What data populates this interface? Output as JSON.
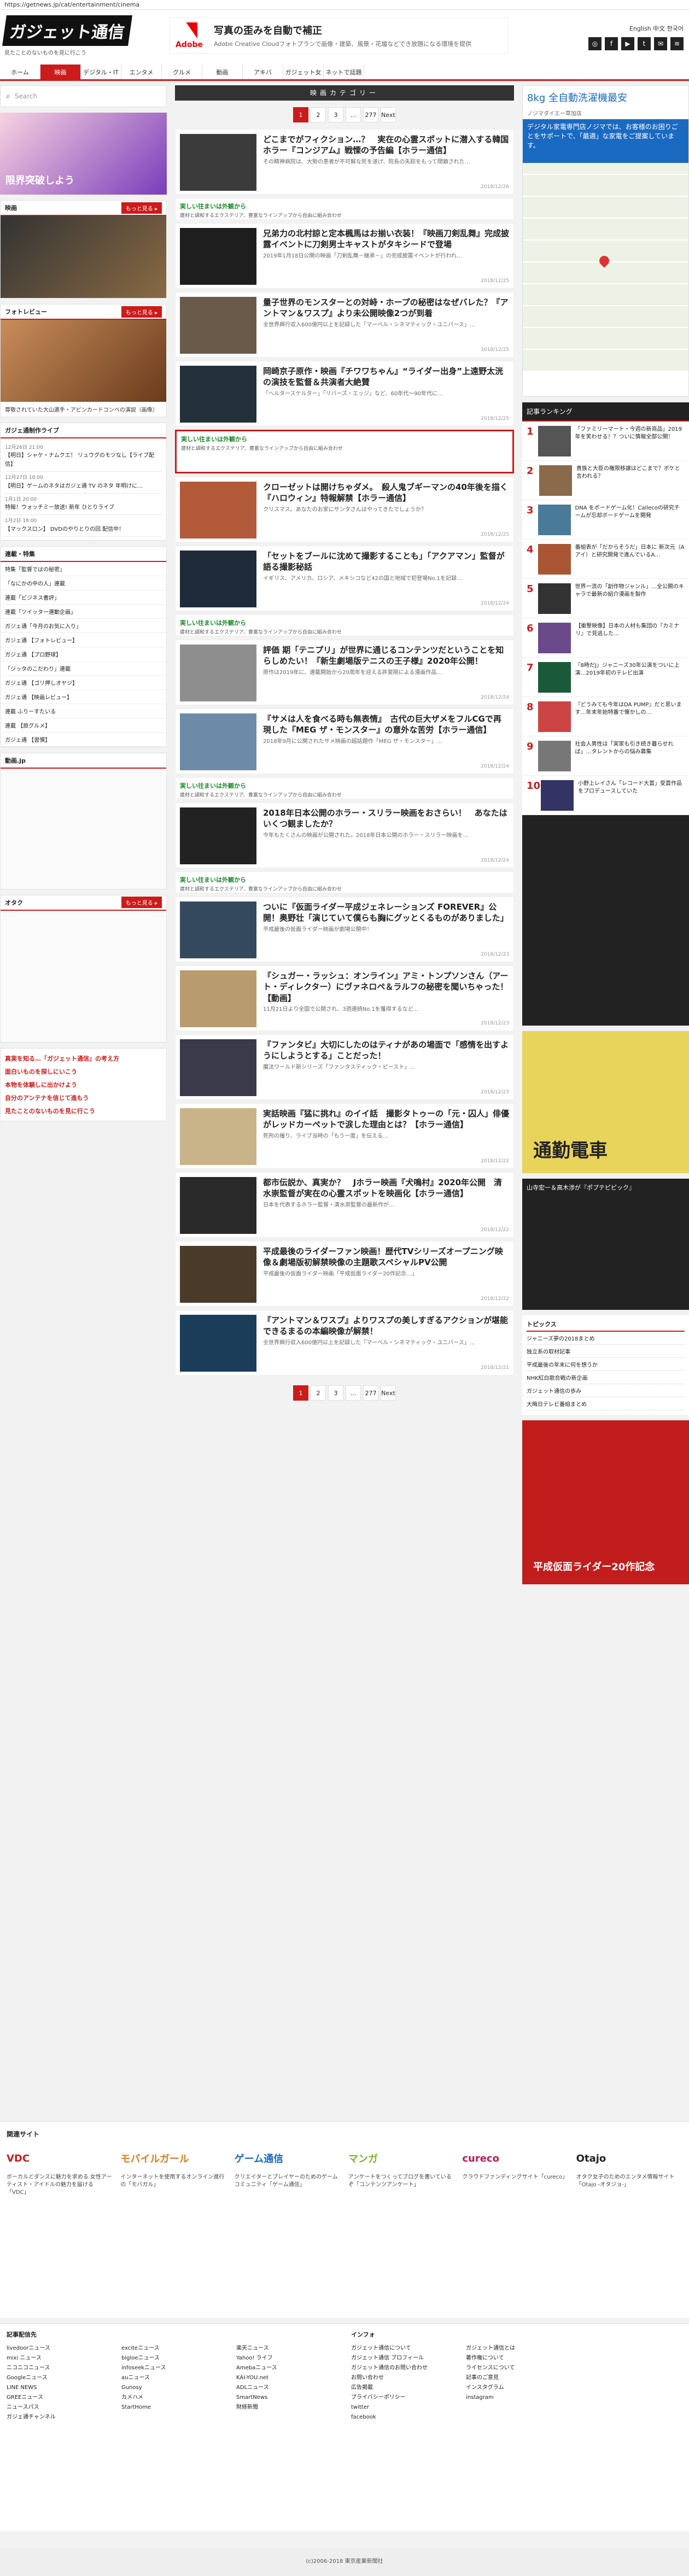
{
  "url": "https://getnews.jp/cat/entertainment/cinema",
  "header": {
    "logo": "ガジェット通信",
    "tagline": "見たことのないものを見に行こう",
    "ad_brand": "Adobe",
    "ad_title": "写真の歪みを自動で補正",
    "ad_sub": "Adobe Creative Cloudフォトプランで画像・建築、風景・花壇などでき放題になる環境を提供",
    "lang": "English 中文 한국어"
  },
  "nav": [
    "ホーム",
    "映画",
    "デジタル・IT",
    "エンタメ",
    "グルメ",
    "動画",
    "アキバ",
    "ガジェット女子",
    "ネットで話題"
  ],
  "left": {
    "search_placeholder": "Search",
    "promo_text": "限界突破しよう",
    "movie_box_title": "映画",
    "photo_box_title": "フォトレビュー",
    "photo_caption": "尊敬されていた大山選手・アビンカードコンベの演説（画像）",
    "update_box_title": "ガジェ通制作ライブ",
    "updates": [
      {
        "ts": "12月26日 21:00",
        "text": "【明日】シャケ・ナムクエ！ リュウグのモツなし【ライブ配信】"
      },
      {
        "ts": "12月27日 18:00",
        "text": "【明日】ゲームのネタはガジェ通 TV のネタ 年明けに…"
      },
      {
        "ts": "1月1日 20:00",
        "text": "特報！ウォッチミー放送! 新年 ひとりライブ"
      },
      {
        "ts": "1月2日 18:00",
        "text": "【マックスロン】 DVDのやりとりの回 配信中！"
      }
    ],
    "tags_title": "連載・特集",
    "tags": [
      "特集「監督ではの秘密」",
      "「なにかの中の人」連載",
      "連載「ビジネス書評」",
      "連載「ツイッター連動企画」",
      "ガジェ通「今月のお気に入り」",
      "ガジェ通 【フォトレビュー】",
      "ガジェ通 【プロ野球】",
      "「ジッタのこだわり」連載",
      "ガジェ通 【ゴリ押しオヤジ】",
      "ガジェ通 【映画レビュー】",
      "連載 ふりーすたいる",
      "連載 【旅グルメ】",
      "ガジェ通 【習慣】"
    ],
    "japan_box": "動画.jp",
    "otaku_box": "オタク",
    "redlinks": [
      "真実を知る…「ガジェット通信」の考え方",
      "面白いものを探しにいこう",
      "本物を体験しに出かけよう",
      "自分のアンテナを信じて進もう",
      "見たことのないものを見に行こう"
    ]
  },
  "center": {
    "cat_title": "映画カテゴリー",
    "pages": [
      "1",
      "2",
      "3",
      "...",
      "277",
      "Next"
    ],
    "sponsor_h": "実しい往まいは外観から",
    "sponsor_d": "建材と調和するエクステリア、豊富なラインアップから自由に組み合わせ",
    "articles": [
      {
        "title": "どこまでがフィクション…？　実在の心霊スポットに潜入する韓国ホラー『コンジアム』戦慄の予告編【ホラー通信】",
        "desc": "その精神病院は、大勢の患者が不可解な死を遂げ、院長の失踪をもって閉鎖された…",
        "meta": "2018/12/26"
      },
      {
        "title": "兄弟力の北村諒と定本楓馬はお揃い衣装！『映画刀剣乱舞』完成披露イベントに刀剣男士キャストがタキシードで登場",
        "desc": "2019年1月18日公開の映画「刀剣乱舞－継承－」の完成披露イベントが行われ…",
        "meta": "2018/12/25"
      },
      {
        "title": "量子世界のモンスターとの対峙・ホープの秘密はなぜバレた？『アントマン＆ワスプ』より未公開映像2つが到着",
        "desc": "全世界興行収入600億円以上を記録した「マーベル・シネマティック・ユニバース」…",
        "meta": "2018/12/25"
      },
      {
        "title": "岡崎京子原作・映画『チワワちゃん』“ライダー出身”上遠野太洸の演技を監督＆共演者大絶賛",
        "desc": "「ヘルタースケルター」「リバーズ・エッジ」など、60年代〜90年代に…",
        "meta": "2018/12/25"
      },
      {
        "title": "クローゼットは開けちゃダメ。　殺人鬼ブギーマンの40年後を描く『ハロウィン』特報解禁【ホラー通信】",
        "desc": "クリスマス。あなたのお家にサンタさんはやってきたでしょうか？",
        "meta": "2018/12/25"
      },
      {
        "title": "「セットをブールに沈めて撮影することも」「アクアマン」監督が語る撮影秘話",
        "desc": "イギリス、アメリカ、ロシア、メキシコなど42の国と地域で初登場No.1を記録…",
        "meta": "2018/12/24"
      },
      {
        "title": "評価 期「テニプリ」が世界に通じるコンテンツだということを知らしめたい！『新生劇場版テニスの王子様』2020年公開！",
        "desc": "原作は2019年に、連載開始から20周年を迎える許斐剛による漫画作品…",
        "meta": "2018/12/24"
      },
      {
        "title": "『サメは人を食べる時も無表情』　古代の巨大ザメをフルCGで再現した『MEG ザ・モンスター』の意外な苦労【ホラー通信】",
        "desc": "2018年9月に公開されたサメ映画の超話題作「MEG ザ・モンスター」…",
        "meta": "2018/12/24"
      },
      {
        "title": "2018年日本公開のホラー・スリラー映画をおさらい！　あなたはいくつ観ましたか？",
        "desc": "今年もたくさんの映画が公開された。2018年日本公開のホラー・スリラー映画を…",
        "meta": "2018/12/24"
      },
      {
        "title": "ついに『仮面ライダー平成ジェネレーションズ FOREVER』公開！奥野壮「演じていて僕らも胸にグッとくるものがありました」",
        "desc": "平成最後の仮面ライダー映画が劇場公開中！",
        "meta": "2018/12/23"
      },
      {
        "title": "『シュガー・ラッシュ：オンライン』アミ・トンプソンさん（アート・ディレクター）にヴァネロペ＆ラルフの秘密を聞いちゃった！【動画】",
        "desc": "11月21日より全国で公開され、3週連続No.1を獲得するなど…",
        "meta": "2018/12/23"
      },
      {
        "title": "『ファンタビ』大切にしたのはティナがあの場面で「感情を出すようにしようとする」ことだった！",
        "desc": "魔法ワールド新シリーズ「ファンタスティック・ビースト」…",
        "meta": "2018/12/23"
      },
      {
        "title": "実話映画『猛に挑れ』のイイ話　撮影タトゥーの「元・囚人」俳優がレッドカーペットで涙した理由とは？【ホラー通信】",
        "desc": "死刑の撮り、ライブ当時の「もう一度」を伝える…",
        "meta": "2018/12/22"
      },
      {
        "title": "都市伝説か、真実か？　Jホラー映画『犬鳴村』2020年公開　清水崇監督が実在の心霊スポットを映画化【ホラー通信】",
        "desc": "日本を代表するホラー監督・清水崇監督の最新作が…",
        "meta": "2018/12/22"
      },
      {
        "title": "平成最後のライダーファン映画！歴代TVシリーズオープニング映像＆劇場版初解禁映像の主題歌スペシャルPV公開",
        "desc": "平成最後の仮面ライダー映画「平成仮面ライダー20作記念…」",
        "meta": "2018/12/22"
      },
      {
        "title": "『アントマン＆ワスプ』よりワスプの美しすぎるアクションが堪能できるまるの本編映像が解禁！",
        "desc": "全世界興行収入600億円以上を記録した「マーベル・シネマティック・ユニバース」…",
        "meta": "2018/12/21"
      }
    ]
  },
  "right": {
    "map_title": "8kg 全自動洗濯機最安",
    "map_sub": "ノジマダイエー草加店",
    "map_blue": "デジタル家電専門店ノジマでは、お客様のお困りごとをサポートで、「最適」な家電をご提案しています。",
    "rank_title": "記事ランキング",
    "ranks": [
      {
        "n": "1",
        "t": "「ファミリーマート・今週の新商品」2019年を笑わせる！？ついに情報全部公開！"
      },
      {
        "n": "2",
        "t": "貴族と大臣の権限移譲はどこまで？ボケと言われる？"
      },
      {
        "n": "3",
        "t": "DNA をボードゲーム化！Callecoの研究チームが忘却ボードゲームを開発"
      },
      {
        "n": "4",
        "t": "番組表が「だからそうだ」日本に 新次元（Aアイ）と研究開発で進んでいるA…"
      },
      {
        "n": "5",
        "t": "世界一流の「創作物ジャンル」…全公開のキャラで最新の紹介漫画を製作"
      },
      {
        "n": "6",
        "t": "【衝撃映像】日本の人材も集団の『カミナリ』で見逃した…"
      },
      {
        "n": "7",
        "t": "『8時だJ』ジャニーズ30年公演をついに上演…2019年初のテレビ出演"
      },
      {
        "n": "8",
        "t": "『どうみても今年はDA PUMP』だと思います…年末年始特番で懐かしの…"
      },
      {
        "n": "9",
        "t": "社会人男性は「実家も引き続き暮らせれば」…タレントからの悩み募集"
      },
      {
        "n": "10",
        "t": "小野上レイさん「レコード大賞」受賞作品をプロデュースしていた"
      }
    ],
    "ad_title": "通勤電車",
    "video_cap": "山寺宏一＆高木渉が『ポプテピピック』",
    "topics_title": "トピックス",
    "topics": [
      "ジャニーズ夢の2018まとめ",
      "独立系の取材記事",
      "平成最後の年末に何を想うか",
      "NHK紅白歌合戦の新企画",
      "ガジェット通信の歩み",
      "大晦日テレビ番組まとめ"
    ],
    "ad2_title": "平成仮面ライダー20作記念"
  },
  "related": {
    "title": "関連サイト",
    "sites": [
      {
        "name": "VDC",
        "desc": "ボーカルとダンスに魅力を求める 女性アーティスト・アイドルの魅力を届ける「VDC」"
      },
      {
        "name": "モバイルガール",
        "desc": "インターネットを使用するオンライン進行の「モバガル」"
      },
      {
        "name": "ゲーム通信",
        "desc": "クリエイターとプレイヤーのためのゲームコミュニティ「ゲーム通信」"
      },
      {
        "name": "マンガ",
        "desc": "アンケートをつくってブログを書いているぞ「コンテンツアンケート」"
      },
      {
        "name": "cureco",
        "desc": "クラウドファンディングサイト「cureco」"
      },
      {
        "name": "Otajo",
        "desc": "オタク女子のためのエンタメ情報サイト「Otajo -オタジョ-」"
      }
    ]
  },
  "footer": {
    "cols": [
      {
        "h": "記事配信先",
        "items": [
          "livedoorニュース",
          "mixi ニュース",
          "ニコニコニュース",
          "Googleニュース",
          "LINE NEWS",
          "GREEニュース",
          "ニュースパス",
          "ガジェ通チャンネル"
        ]
      },
      {
        "h": "",
        "items": [
          "exciteニュース",
          "bigloeニュース",
          "infoseekニュース",
          "auニュース",
          "Gunosy",
          "カメハメ",
          "StartHome"
        ]
      },
      {
        "h": "",
        "items": [
          "楽天ニュース",
          "Yahoo! ライフ",
          "Amebaニュース",
          "KAI-YOU.net",
          "ADLニュース",
          "SmartNews",
          "財経新聞"
        ]
      },
      {
        "h": "インフォ",
        "items": [
          "ガジェット通信について",
          "ガジェット通信 プロフィール",
          "ガジェット通信のお問い合わせ",
          "お問い合わせ",
          "広告掲載",
          "プライバシーポリシー",
          "twitter",
          "facebook"
        ]
      },
      {
        "h": "",
        "items": [
          "ガジェット通信とは",
          "著作権について",
          "ライセンスについて",
          "記事のご意見",
          "インスタグラム",
          "instagram"
        ]
      }
    ]
  },
  "copyright": "(c)2006-2018 東京産業新聞社"
}
